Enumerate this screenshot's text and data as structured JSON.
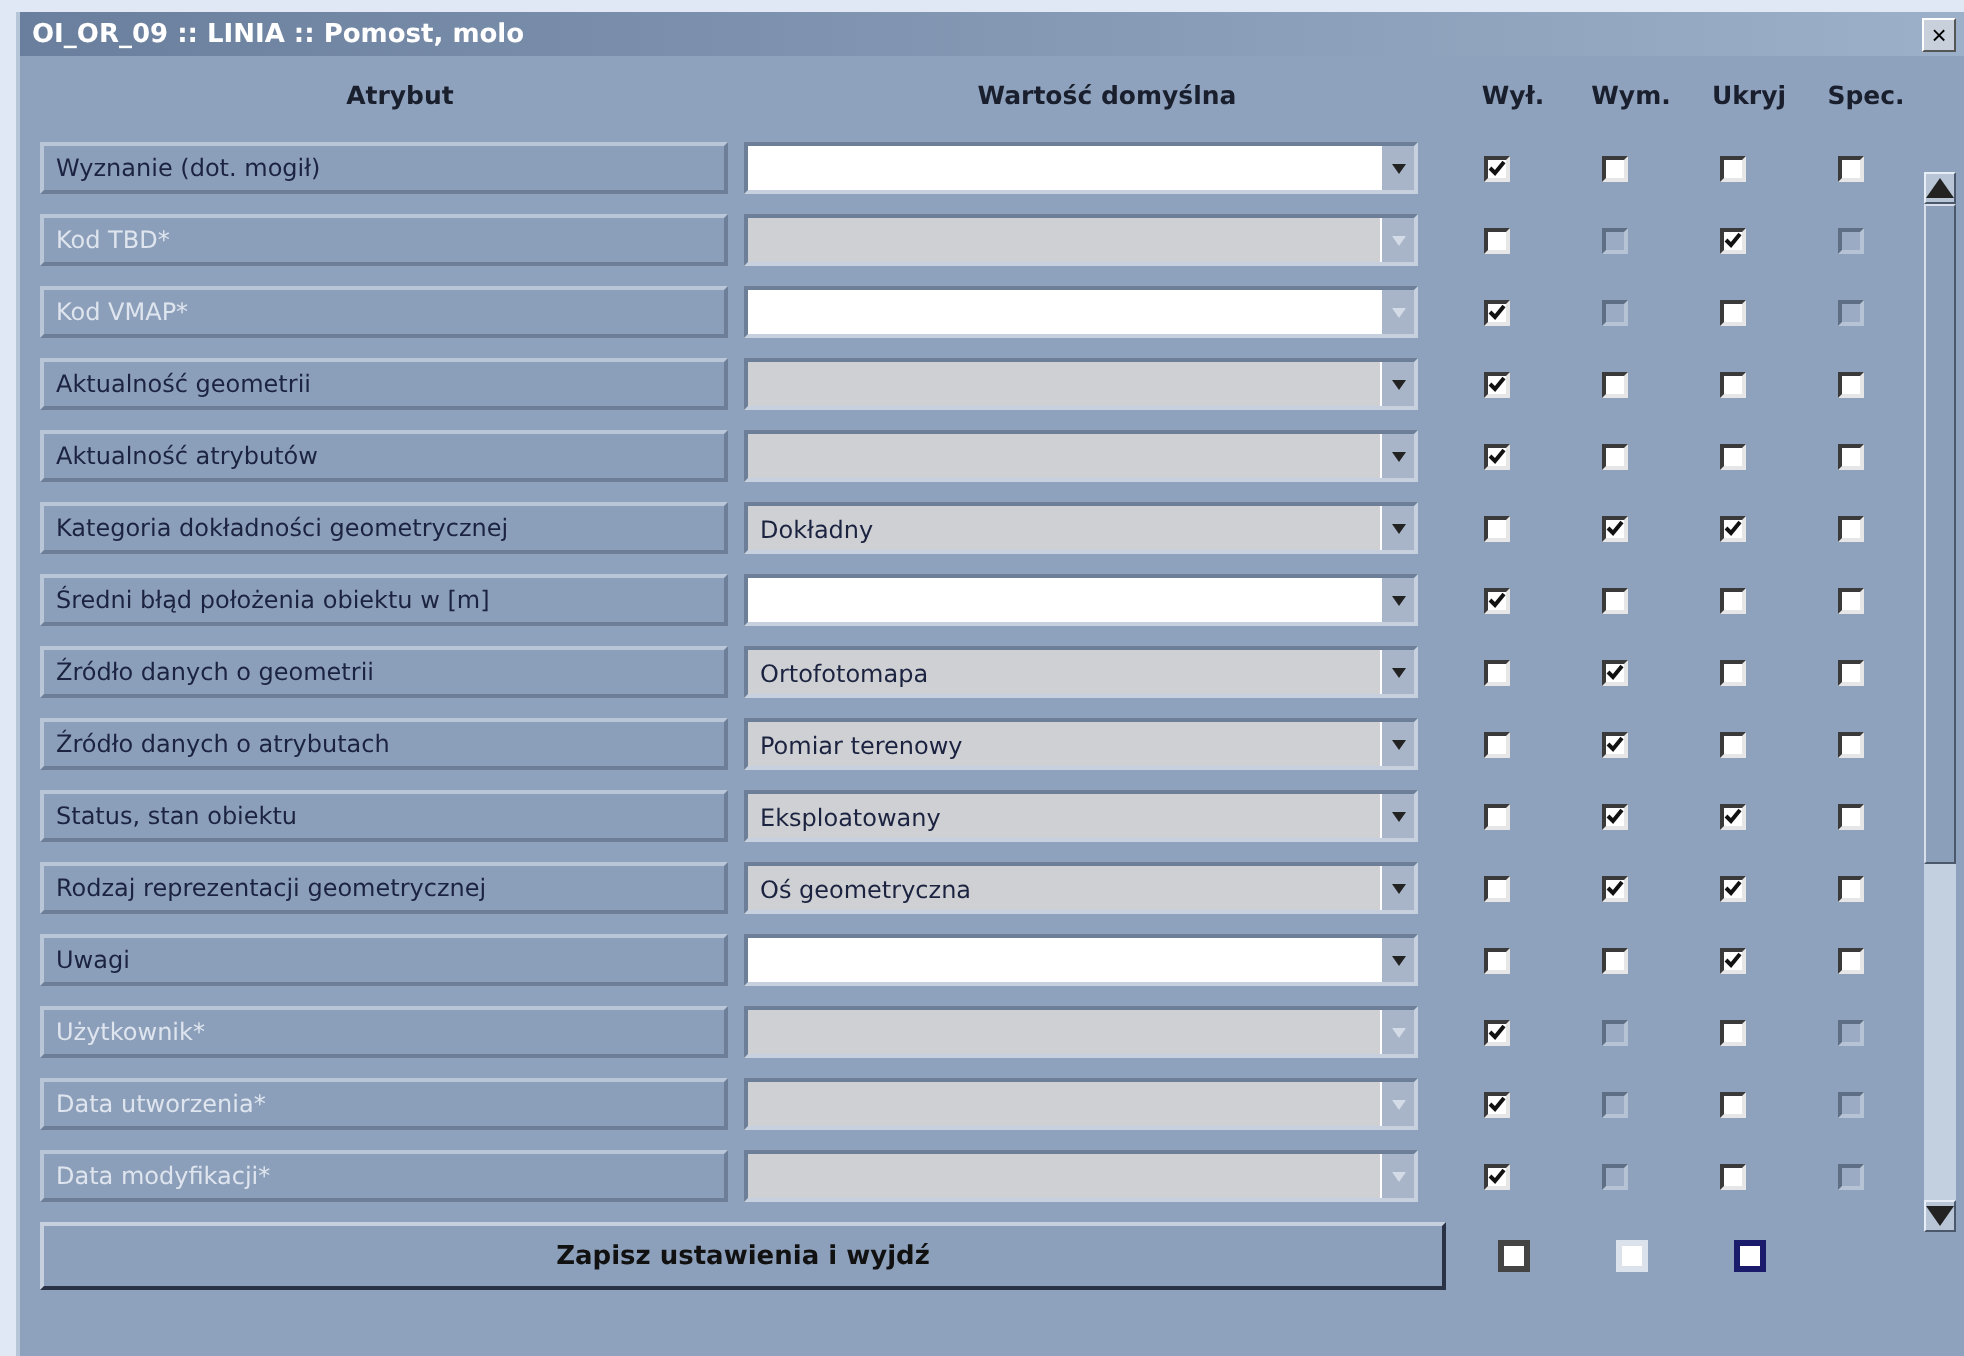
{
  "window": {
    "title": "OI_OR_09 :: LINIA :: Pomost, molo",
    "close": "×"
  },
  "columns": [
    "Atrybut",
    "Wartość domyślna",
    "Wył.",
    "Wym.",
    "Ukryj",
    "Spec."
  ],
  "rows": [
    {
      "label": "Wyznanie (dot. mogił)",
      "disabled": false,
      "editable": true,
      "checks": [
        {
          "checked": true,
          "disabled": false
        },
        {
          "checked": false,
          "disabled": false
        },
        {
          "checked": false,
          "disabled": false
        },
        {
          "checked": false,
          "disabled": false
        }
      ]
    },
    {
      "label": "Kod TBD*",
      "disabled": true,
      "editable": false,
      "checks": [
        {
          "checked": false,
          "disabled": false
        },
        {
          "checked": false,
          "disabled": true
        },
        {
          "checked": true,
          "disabled": false
        },
        {
          "checked": false,
          "disabled": true
        }
      ]
    },
    {
      "label": "Kod VMAP*",
      "disabled": true,
      "editable": true,
      "checks": [
        {
          "checked": true,
          "disabled": false
        },
        {
          "checked": false,
          "disabled": true
        },
        {
          "checked": false,
          "disabled": false
        },
        {
          "checked": false,
          "disabled": true
        }
      ]
    },
    {
      "label": "Aktualność geometrii",
      "disabled": false,
      "editable": false,
      "checks": [
        {
          "checked": true,
          "disabled": false
        },
        {
          "checked": false,
          "disabled": false
        },
        {
          "checked": false,
          "disabled": false
        },
        {
          "checked": false,
          "disabled": false
        }
      ]
    },
    {
      "label": "Aktualność atrybutów",
      "disabled": false,
      "editable": false,
      "checks": [
        {
          "checked": true,
          "disabled": false
        },
        {
          "checked": false,
          "disabled": false
        },
        {
          "checked": false,
          "disabled": false
        },
        {
          "checked": false,
          "disabled": false
        }
      ]
    },
    {
      "label": "Kategoria dokładności geometrycznej",
      "value": "Dokładny",
      "disabled": false,
      "editable": false,
      "checks": [
        {
          "checked": false,
          "disabled": false
        },
        {
          "checked": true,
          "disabled": false
        },
        {
          "checked": true,
          "disabled": false
        },
        {
          "checked": false,
          "disabled": false
        }
      ]
    },
    {
      "label": "Średni błąd położenia obiektu w [m]",
      "disabled": false,
      "editable": true,
      "checks": [
        {
          "checked": true,
          "disabled": false
        },
        {
          "checked": false,
          "disabled": false
        },
        {
          "checked": false,
          "disabled": false
        },
        {
          "checked": false,
          "disabled": false
        }
      ]
    },
    {
      "label": "Źródło danych o geometrii",
      "value": "Ortofotomapa",
      "disabled": false,
      "editable": false,
      "checks": [
        {
          "checked": false,
          "disabled": false
        },
        {
          "checked": true,
          "disabled": false
        },
        {
          "checked": false,
          "disabled": false
        },
        {
          "checked": false,
          "disabled": false
        }
      ]
    },
    {
      "label": "Źródło danych o atrybutach",
      "value": "Pomiar terenowy",
      "disabled": false,
      "editable": false,
      "checks": [
        {
          "checked": false,
          "disabled": false
        },
        {
          "checked": true,
          "disabled": false
        },
        {
          "checked": false,
          "disabled": false
        },
        {
          "checked": false,
          "disabled": false
        }
      ]
    },
    {
      "label": "Status, stan obiektu",
      "value": "Eksploatowany",
      "disabled": false,
      "editable": false,
      "checks": [
        {
          "checked": false,
          "disabled": false
        },
        {
          "checked": true,
          "disabled": false
        },
        {
          "checked": true,
          "disabled": false
        },
        {
          "checked": false,
          "disabled": false
        }
      ]
    },
    {
      "label": "Rodzaj reprezentacji geometrycznej",
      "value": "Oś geometryczna",
      "disabled": false,
      "editable": false,
      "checks": [
        {
          "checked": false,
          "disabled": false
        },
        {
          "checked": true,
          "disabled": false
        },
        {
          "checked": true,
          "disabled": false
        },
        {
          "checked": false,
          "disabled": false
        }
      ]
    },
    {
      "label": "Uwagi",
      "disabled": false,
      "editable": true,
      "checks": [
        {
          "checked": false,
          "disabled": false
        },
        {
          "checked": false,
          "disabled": false
        },
        {
          "checked": true,
          "disabled": false
        },
        {
          "checked": false,
          "disabled": false
        }
      ]
    },
    {
      "label": "Użytkownik*",
      "disabled": true,
      "editable": false,
      "checks": [
        {
          "checked": true,
          "disabled": false
        },
        {
          "checked": false,
          "disabled": true
        },
        {
          "checked": false,
          "disabled": false
        },
        {
          "checked": false,
          "disabled": true
        }
      ]
    },
    {
      "label": "Data utworzenia*",
      "disabled": true,
      "editable": false,
      "checks": [
        {
          "checked": true,
          "disabled": false
        },
        {
          "checked": false,
          "disabled": true
        },
        {
          "checked": false,
          "disabled": false
        },
        {
          "checked": false,
          "disabled": true
        }
      ]
    },
    {
      "label": "Data modyfikacji*",
      "disabled": true,
      "editable": false,
      "checks": [
        {
          "checked": true,
          "disabled": false
        },
        {
          "checked": false,
          "disabled": true
        },
        {
          "checked": false,
          "disabled": false
        },
        {
          "checked": false,
          "disabled": true
        }
      ]
    }
  ],
  "save_button": "Zapisz ustawienia i wyjdź",
  "bottom_checkboxes": [
    {
      "checked": false,
      "kind": "dark"
    },
    {
      "checked": false,
      "kind": "light"
    },
    {
      "checked": false,
      "kind": "focused"
    }
  ]
}
